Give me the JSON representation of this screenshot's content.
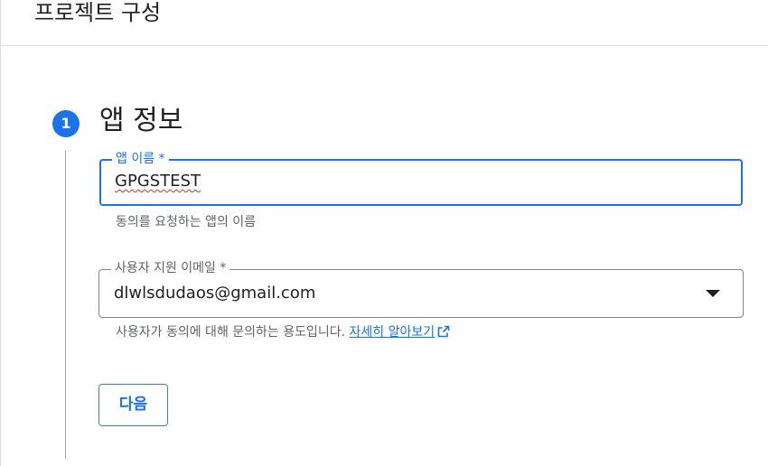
{
  "header": {
    "title": "프로젝트 구성"
  },
  "step": {
    "number": "1",
    "title": "앱 정보"
  },
  "app_name_field": {
    "label": "앱 이름 *",
    "value": "GPGSTEST",
    "hint": "동의를 요청하는 앱의 이름"
  },
  "support_email_field": {
    "label": "사용자 지원 이메일 *",
    "selected_value": "dlwlsdudaos@gmail.com",
    "hint": "사용자가 동의에 대해 문의하는 용도입니다.",
    "learn_more_label": "자세히 알아보기"
  },
  "actions": {
    "next_label": "다음"
  },
  "colors": {
    "accent": "#1a73e8",
    "text_primary": "#202124",
    "text_secondary": "#5f6368",
    "divider": "#dadce0",
    "spellcheck_error": "#d93025"
  },
  "icons": {
    "dropdown": "arrow-drop-down-icon",
    "external_link": "open-in-new-icon"
  }
}
